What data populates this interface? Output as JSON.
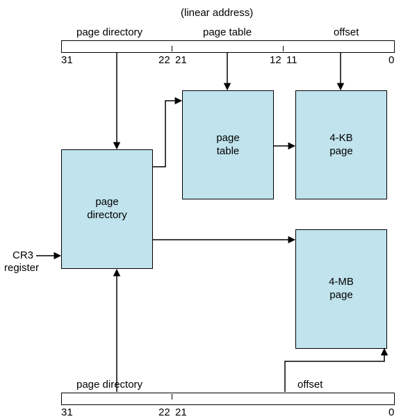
{
  "title": "(linear address)",
  "top_bar": {
    "fields": [
      {
        "label": "page directory",
        "start": "31",
        "end": "22"
      },
      {
        "label": "page table",
        "start": "21",
        "end": "12"
      },
      {
        "label": "offset",
        "start": "11",
        "end": "0"
      }
    ]
  },
  "bottom_bar": {
    "fields": [
      {
        "label": "page directory",
        "start": "31",
        "end": "22"
      },
      {
        "label": "offset",
        "start": "21",
        "end": "0"
      }
    ]
  },
  "boxes": {
    "page_directory": "page\ndirectory",
    "page_table": "page\ntable",
    "page_4kb": "4-KB\npage",
    "page_4mb": "4-MB\npage"
  },
  "cr3_top": "CR3",
  "cr3_bot": "register"
}
